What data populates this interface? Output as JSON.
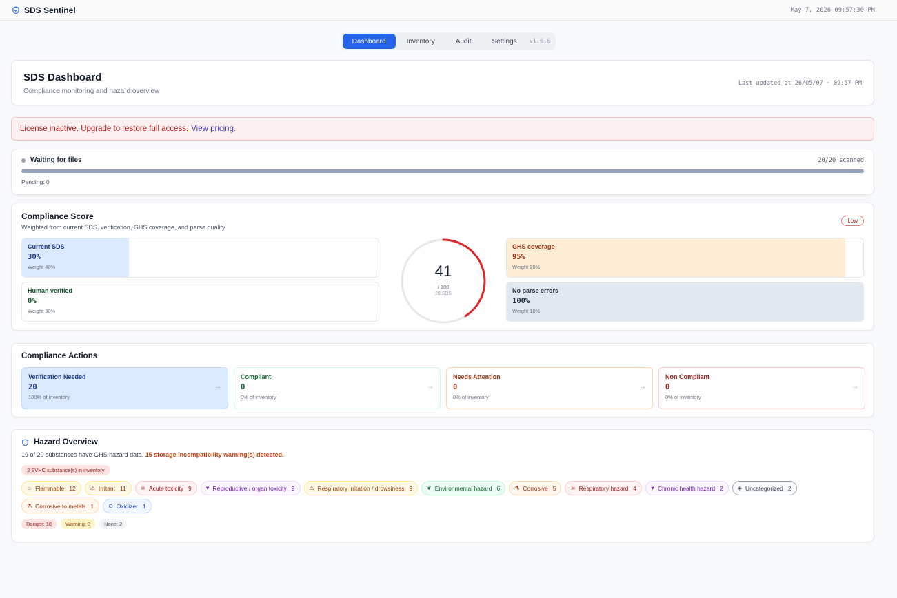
{
  "app": {
    "name": "SDS Sentinel",
    "clock": "May 7, 2026 09:57:30 PM"
  },
  "nav": {
    "tabs": [
      {
        "label": "Dashboard",
        "active": true
      },
      {
        "label": "Inventory",
        "active": false
      },
      {
        "label": "Audit",
        "active": false
      },
      {
        "label": "Settings",
        "active": false
      }
    ],
    "version": "v1.0.0"
  },
  "header": {
    "title": "SDS Dashboard",
    "subtitle": "Compliance monitoring and hazard overview",
    "last_updated": "Last updated at 26/05/07 · 09:57 PM"
  },
  "license": {
    "message": "License inactive. Upgrade to restore full access.",
    "link": "View pricing",
    "suffix": "."
  },
  "scan": {
    "status": "Waiting for files",
    "scanned": "20/20 scanned",
    "progress": 1.0,
    "pending": "Pending: 0"
  },
  "score": {
    "title": "Compliance Score",
    "description": "Weighted from current SDS, verification, GHS coverage, and parse quality.",
    "level": "Low",
    "value": "41",
    "value_num": 41,
    "out_of": "/ 100",
    "count": "20 SDS",
    "metrics": [
      {
        "label": "Current SDS",
        "value": "30%",
        "weight": "Weight 40%",
        "fill": 0.3,
        "color": "#dbeafe",
        "text_color": "#1e3a8a"
      },
      {
        "label": "Human verified",
        "value": "0%",
        "weight": "Weight 30%",
        "fill": 0.0,
        "color": "#dcfce7",
        "text_color": "#14532d"
      },
      {
        "label": "GHS coverage",
        "value": "95%",
        "weight": "Weight 20%",
        "fill": 0.95,
        "color": "#ffedd5",
        "text_color": "#9a3412"
      },
      {
        "label": "No parse errors",
        "value": "100%",
        "weight": "Weight 10%",
        "fill": 1.0,
        "color": "#e2e8f0",
        "text_color": "#1e293b"
      }
    ]
  },
  "actions": {
    "title": "Compliance Actions",
    "items": [
      {
        "label": "Verification Needed",
        "value": "20",
        "pct": "100% of inventory",
        "bg": "#dbeafe",
        "border": "#bfdbfe",
        "color": "#1e3a8a"
      },
      {
        "label": "Compliant",
        "value": "0",
        "pct": "0% of inventory",
        "bg": "#ffffff",
        "border": "#d1fae5",
        "color": "#166534"
      },
      {
        "label": "Needs Attention",
        "value": "0",
        "pct": "0% of inventory",
        "bg": "#ffffff",
        "border": "#fed7aa",
        "color": "#9a3412"
      },
      {
        "label": "Non Compliant",
        "value": "0",
        "pct": "0% of inventory",
        "bg": "#ffffff",
        "border": "#fecaca",
        "color": "#991b1b"
      }
    ]
  },
  "hazard": {
    "title": "Hazard Overview",
    "summary": "19 of 20 substances have GHS hazard data.",
    "warning": "15 storage incompatibility warning(s) detected.",
    "svhc": "2 SVHC substance(s) in inventory",
    "chips": [
      {
        "icon": "flame-icon",
        "glyph": "♨",
        "label": "Flammable",
        "count": "12",
        "bg": "#fef9e7",
        "border": "#fde68a",
        "color": "#92400e"
      },
      {
        "icon": "warning-icon",
        "glyph": "⚠",
        "label": "Irritant",
        "count": "11",
        "bg": "#fef9e7",
        "border": "#fde68a",
        "color": "#92400e"
      },
      {
        "icon": "skull-icon",
        "glyph": "☠",
        "label": "Acute toxicity",
        "count": "9",
        "bg": "#fef2f2",
        "border": "#fecaca",
        "color": "#991b1b"
      },
      {
        "icon": "heart-icon",
        "glyph": "♥",
        "label": "Reproductive / organ toxicity",
        "count": "9",
        "bg": "#faf5ff",
        "border": "#e9d5ff",
        "color": "#6b21a8"
      },
      {
        "icon": "warning-icon",
        "glyph": "⚠",
        "label": "Respiratory irritation / drowsiness",
        "count": "9",
        "bg": "#fef9e7",
        "border": "#fde68a",
        "color": "#92400e"
      },
      {
        "icon": "leaf-icon",
        "glyph": "❦",
        "label": "Environmental hazard",
        "count": "6",
        "bg": "#ecfdf5",
        "border": "#bbf7d0",
        "color": "#166534"
      },
      {
        "icon": "flask-icon",
        "glyph": "⚗",
        "label": "Corrosive",
        "count": "5",
        "bg": "#fff7ed",
        "border": "#fed7aa",
        "color": "#9a3412"
      },
      {
        "icon": "skull-icon",
        "glyph": "☠",
        "label": "Respiratory hazard",
        "count": "4",
        "bg": "#fef2f2",
        "border": "#fecaca",
        "color": "#991b1b"
      },
      {
        "icon": "heart-icon",
        "glyph": "♥",
        "label": "Chronic health hazard",
        "count": "2",
        "bg": "#faf5ff",
        "border": "#e9d5ff",
        "color": "#6b21a8"
      },
      {
        "icon": "shield-icon",
        "glyph": "◈",
        "label": "Uncategorized",
        "count": "2",
        "bg": "#f9fafb",
        "border": "#9ca3af",
        "color": "#374151"
      },
      {
        "icon": "flask-icon",
        "glyph": "⚗",
        "label": "Corrosive to metals",
        "count": "1",
        "bg": "#fff7ed",
        "border": "#fed7aa",
        "color": "#9a3412"
      },
      {
        "icon": "circle-icon",
        "glyph": "⊙",
        "label": "Oxidizer",
        "count": "1",
        "bg": "#eff6ff",
        "border": "#bfdbfe",
        "color": "#1e40af"
      }
    ],
    "severity": [
      {
        "label": "Danger: 18",
        "bg": "#fde2e2",
        "color": "#991b1b"
      },
      {
        "label": "Warning: 0",
        "bg": "#fef3c7",
        "color": "#92400e"
      },
      {
        "label": "None: 2",
        "bg": "#f3f4f6",
        "color": "#4b5563"
      }
    ]
  }
}
